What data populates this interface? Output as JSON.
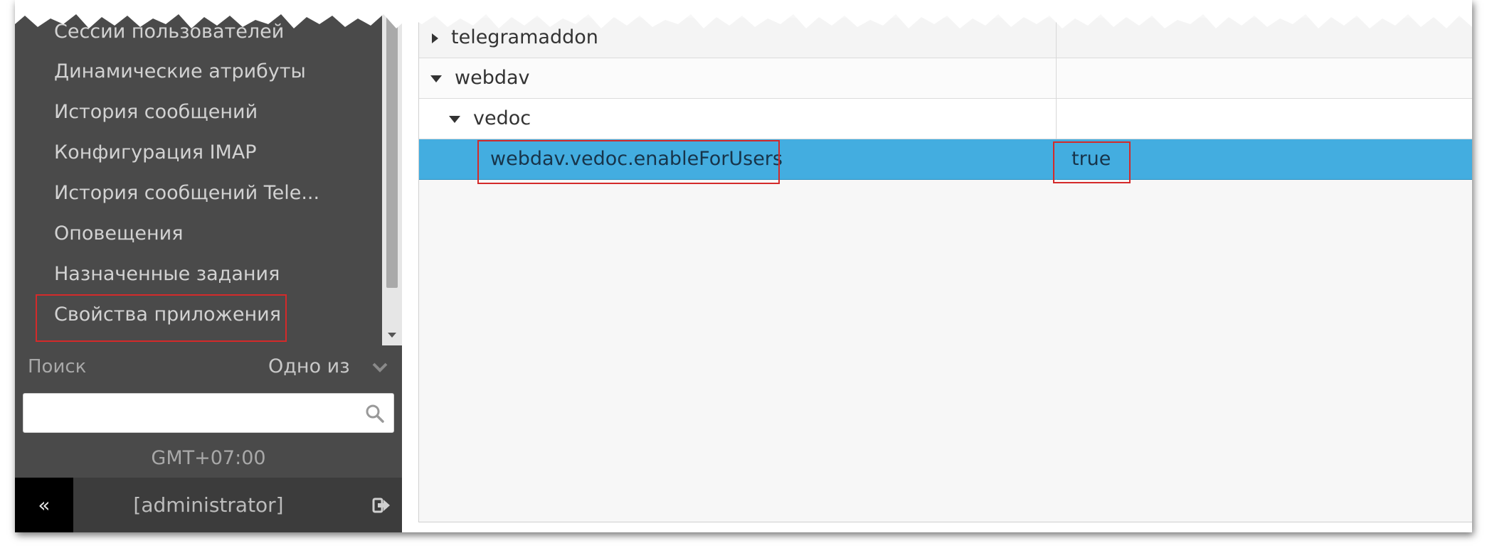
{
  "sidebar": {
    "menu_items": [
      "Сессии пользователей",
      "Динамические атрибуты",
      "История сообщений",
      "Конфигурация IMAP",
      "История сообщений Tele...",
      "Оповещения",
      "Назначенные задания",
      "Свойства приложения"
    ],
    "search_label": "Поиск",
    "filter_mode": "Одно из",
    "search_value": "",
    "timezone": "GMT+07:00",
    "collapse_label": "«",
    "username": "[administrator]"
  },
  "tree": {
    "rows": [
      {
        "name": "telegramaddon",
        "value": "",
        "expanded": false,
        "level": 0
      },
      {
        "name": "webdav",
        "value": "",
        "expanded": true,
        "level": 0
      },
      {
        "name": "vedoc",
        "value": "",
        "expanded": true,
        "level": 1
      },
      {
        "name": "webdav.vedoc.enableForUsers",
        "value": "true",
        "selected": true,
        "level": 2
      }
    ]
  },
  "colors": {
    "sidebar_bg": "#4a4a4a",
    "selected_row": "#43ade0",
    "annotation_red": "#d42a2a"
  }
}
